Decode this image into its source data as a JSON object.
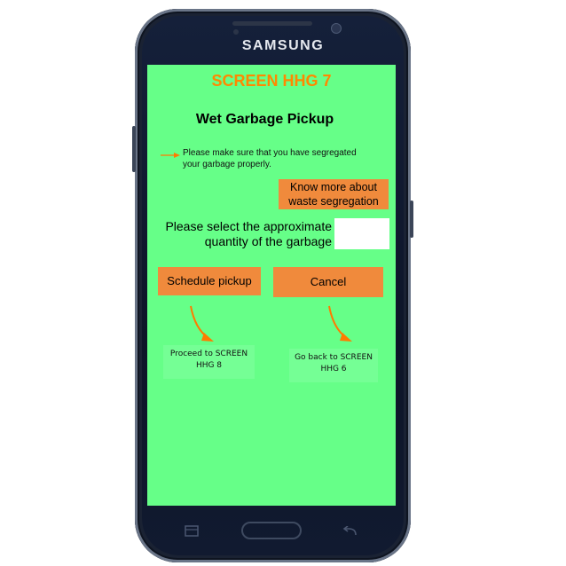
{
  "device": {
    "brand": "SAMSUNG"
  },
  "screen": {
    "title": "SCREEN HHG 7",
    "heading": "Wet Garbage Pickup",
    "note_line1": "Please make sure that you have segregated",
    "note_line2": "your garbage properly.",
    "know_more_line1": "Know more about",
    "know_more_line2": "waste segregation",
    "select_line1": "Please select the approximate",
    "select_line2": "quantity of the garbage",
    "quantity_value": "",
    "schedule_label": "Schedule pickup",
    "cancel_label": "Cancel",
    "proceed_line1": "Proceed to SCREEN",
    "proceed_line2": "HHG 8",
    "goback_line1": "Go back to SCREEN",
    "goback_line2": "HHG 6"
  },
  "colors": {
    "screen_bg": "#66ff88",
    "title": "#ff8800",
    "button": "#f08a3c",
    "phone_body": "#1a2233"
  },
  "icons": [
    "arrow-right-icon",
    "curved-arrow-icon",
    "recent-apps-icon",
    "back-icon",
    "home-button"
  ]
}
